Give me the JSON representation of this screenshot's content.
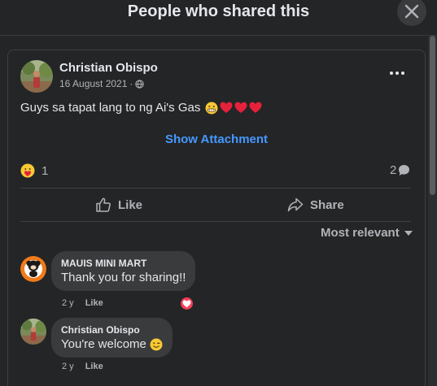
{
  "modal": {
    "title": "People who shared this",
    "close_icon": "close-icon"
  },
  "post": {
    "author": "Christian Obispo",
    "date": "16 August 2021",
    "separator": "·",
    "privacy_icon": "globe-icon",
    "more_icon": "more-horizontal-icon",
    "text": "Guys sa tapat lang to ng Ai's Gas",
    "text_emojis": [
      "grimacing-face-emoji",
      "red-heart-emoji",
      "red-heart-emoji",
      "red-heart-emoji"
    ],
    "show_attachment_label": "Show Attachment",
    "reaction_icon": "care-reaction-icon",
    "reaction_count": "1",
    "comment_count": "2",
    "comment_icon": "speech-bubble-icon",
    "actions": {
      "like_label": "Like",
      "like_icon": "thumbs-up-icon",
      "share_label": "Share",
      "share_icon": "share-arrow-icon"
    },
    "sort_label": "Most relevant",
    "sort_icon": "caret-down-icon"
  },
  "comments": [
    {
      "author": "MAUIS MINI MART",
      "text": "Thank you for sharing!!",
      "age": "2 y",
      "like_label": "Like",
      "reaction_icon": "heart-reaction-icon"
    },
    {
      "author": "Christian Obispo",
      "text": "You're welcome",
      "text_emoji": "winking-face-emoji",
      "age": "2 y",
      "like_label": "Like"
    }
  ],
  "colors": {
    "background": "#242526",
    "bubble": "#3a3b3c",
    "link": "#4599ff",
    "text": "#e4e6eb",
    "muted": "#b0b3b8",
    "heart": "#f33e58"
  }
}
